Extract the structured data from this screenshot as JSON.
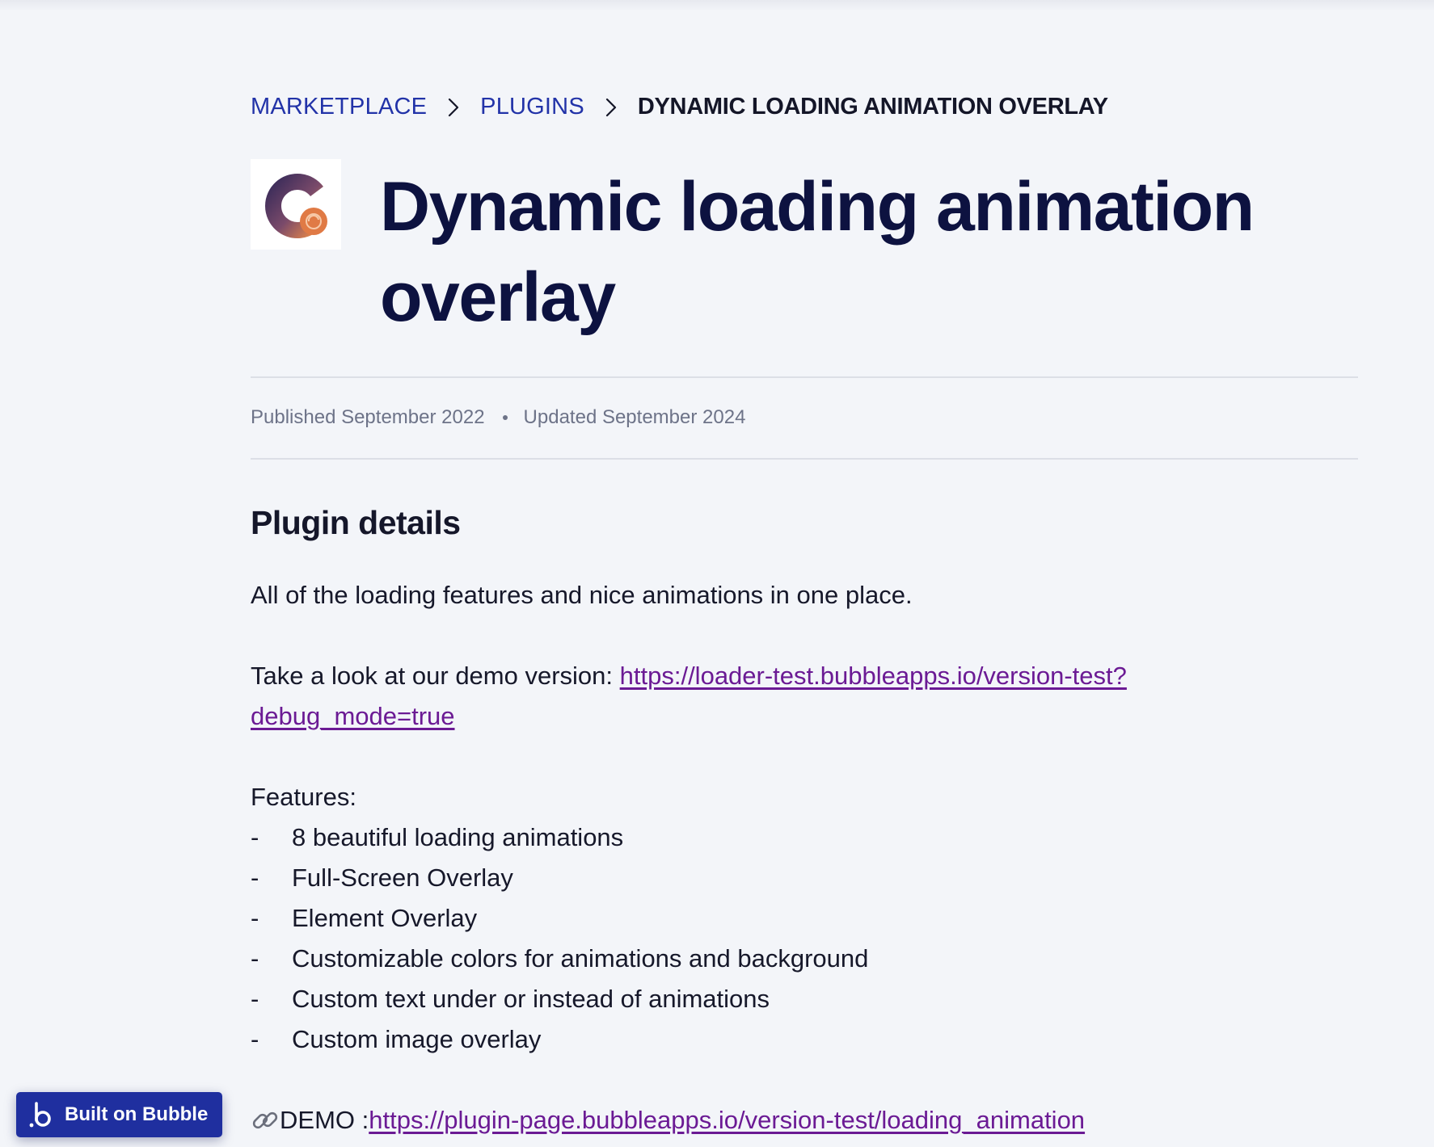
{
  "breadcrumb": {
    "items": [
      {
        "label": "MARKETPLACE"
      },
      {
        "label": "PLUGINS"
      }
    ],
    "current": "DYNAMIC LOADING ANIMATION OVERLAY"
  },
  "plugin": {
    "title": "Dynamic loading animation overlay",
    "logo_icon": "plugin-logo-c-icon",
    "published": "Published September 2022",
    "updated": "Updated September 2024"
  },
  "details": {
    "heading": "Plugin details",
    "intro": "All of the loading features and nice animations in one place.",
    "demo_prefix": "Take a look at our demo version: ",
    "demo_url": "https://loader-test.bubbleapps.io/version-test?debug_mode=true",
    "features_label": "Features:",
    "features": [
      {
        "dash": "-",
        "text": "8 beautiful loading animations"
      },
      {
        "dash": "-",
        "text": "Full-Screen Overlay"
      },
      {
        "dash": "-",
        "text": "Element Overlay"
      },
      {
        "dash": "-",
        "text": "Customizable colors for animations and background"
      },
      {
        "dash": "-",
        "text": "Custom text under or instead of animations"
      },
      {
        "dash": "-",
        "text": "Custom image overlay"
      }
    ],
    "demo2_label": "DEMO : ",
    "demo2_url": "https://plugin-page.bubbleapps.io/version-test/loading_animation"
  },
  "badge": {
    "label": "Built on Bubble"
  },
  "colors": {
    "background": "#f3f5f9",
    "title": "#0d1240",
    "breadcrumb_link": "#2233a8",
    "link": "#6b1a94",
    "badge": "#1f2f9f",
    "logo_dark": "#3a2e55",
    "logo_orange": "#e07a45"
  }
}
